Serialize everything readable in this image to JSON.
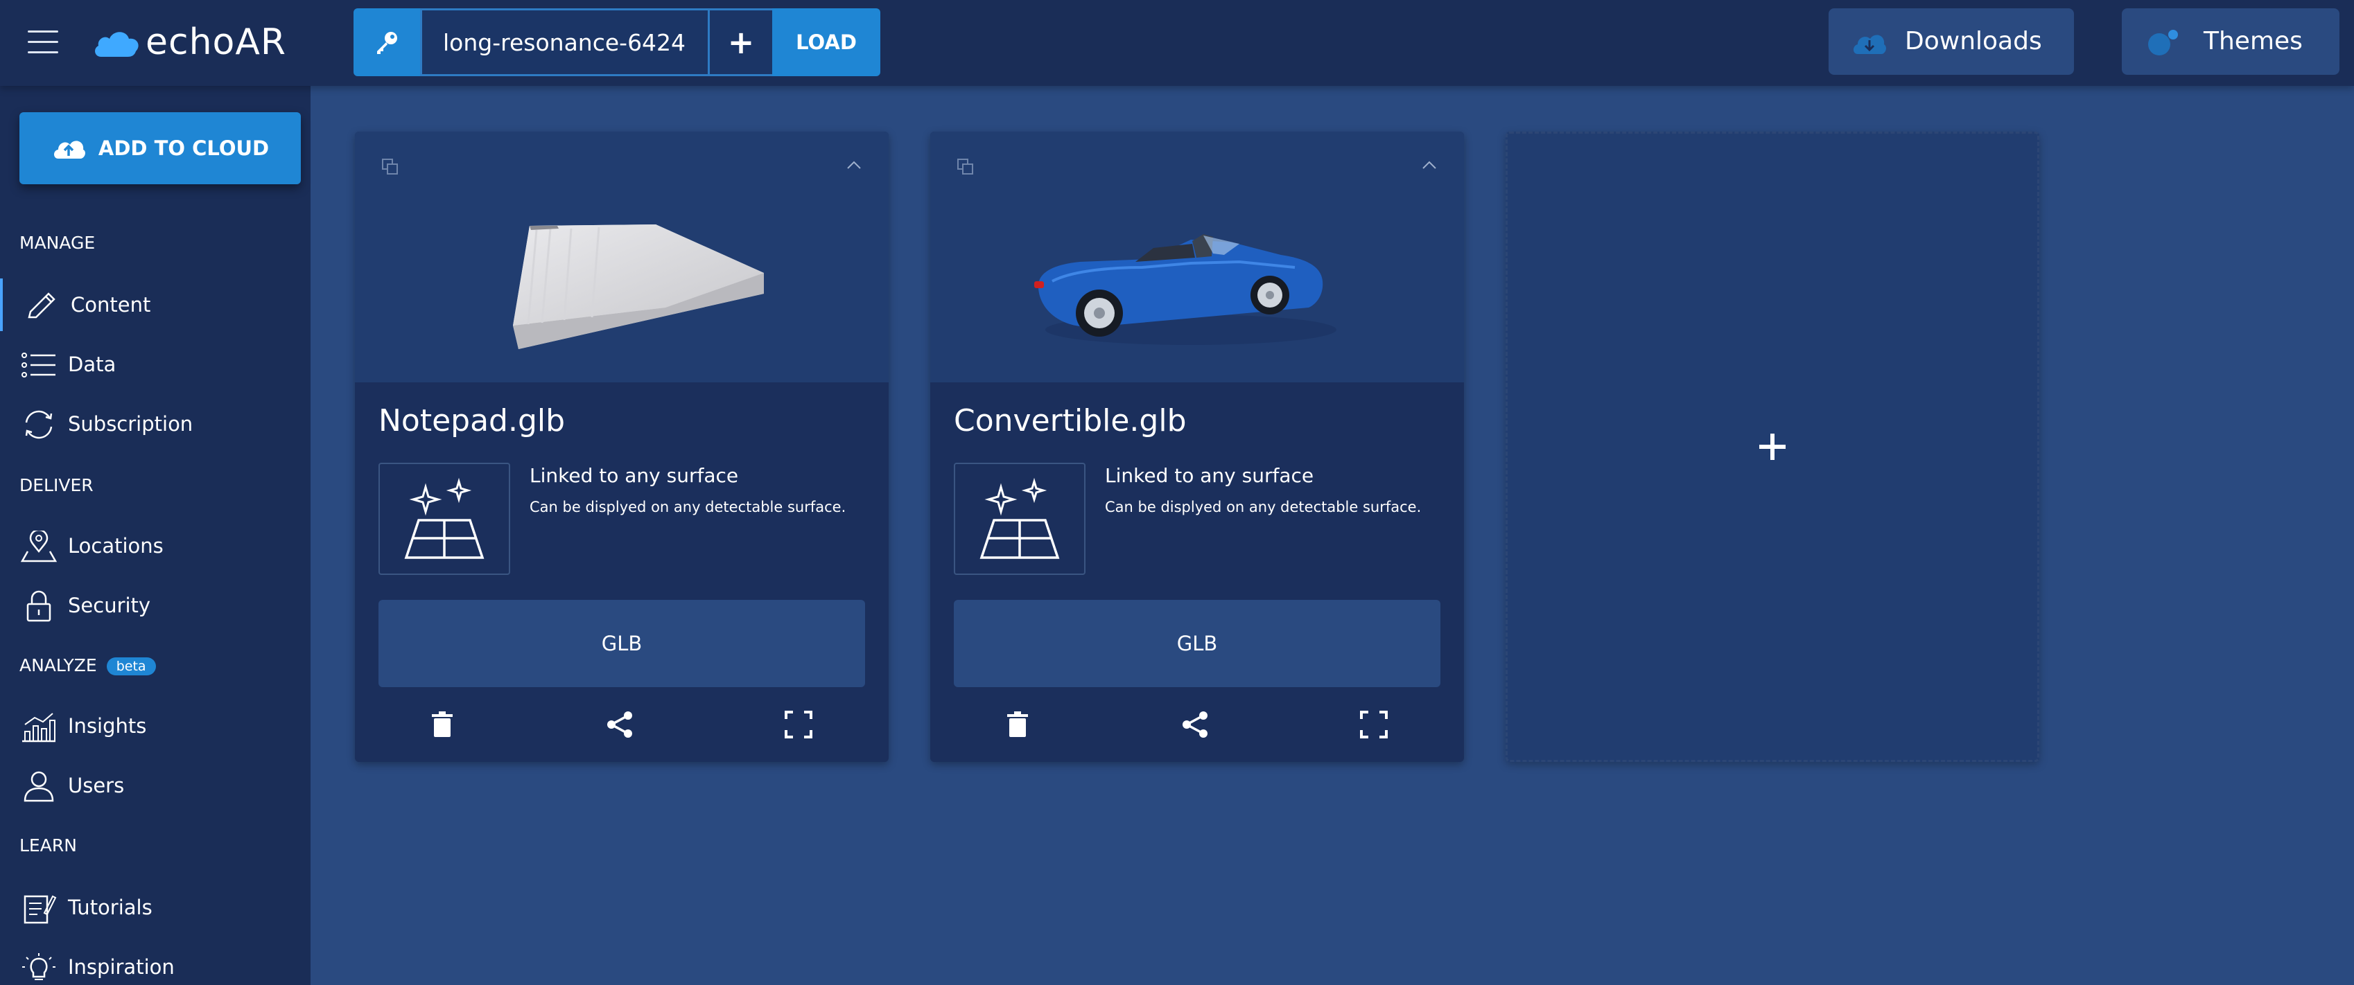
{
  "app": {
    "name": "echoAR"
  },
  "header": {
    "api_key": "long-resonance-6424",
    "plus_label": "+",
    "load_label": "LOAD",
    "downloads_label": "Downloads",
    "themes_label": "Themes"
  },
  "sidebar": {
    "add_to_cloud_label": "ADD TO CLOUD",
    "sections": {
      "manage": "MANAGE",
      "deliver": "DELIVER",
      "analyze": "ANALYZE",
      "analyze_badge": "beta",
      "learn": "LEARN"
    },
    "items": [
      {
        "label": "Content",
        "icon": "pencil-icon",
        "active": true
      },
      {
        "label": "Data",
        "icon": "list-icon"
      },
      {
        "label": "Subscription",
        "icon": "refresh-icon"
      },
      {
        "label": "Locations",
        "icon": "map-pin-icon"
      },
      {
        "label": "Security",
        "icon": "lock-icon"
      },
      {
        "label": "Insights",
        "icon": "bar-chart-icon"
      },
      {
        "label": "Users",
        "icon": "user-icon"
      },
      {
        "label": "Tutorials",
        "icon": "notebook-icon"
      },
      {
        "label": "Inspiration",
        "icon": "lightbulb-icon"
      }
    ]
  },
  "cards": [
    {
      "title": "Notepad.glb",
      "surface_title": "Linked to any surface",
      "surface_desc": "Can be displyed on any detectable surface.",
      "format_label": "GLB",
      "model_icon": "notepad-model-icon"
    },
    {
      "title": "Convertible.glb",
      "surface_title": "Linked to any surface",
      "surface_desc": "Can be displyed on any detectable surface.",
      "format_label": "GLB",
      "model_icon": "car-model-icon"
    }
  ],
  "add_card": {
    "symbol": "+"
  },
  "colors": {
    "background": "#2a4a80",
    "header": "#1a2d57",
    "accent": "#1f86d4",
    "card": "#1b2f5c"
  }
}
